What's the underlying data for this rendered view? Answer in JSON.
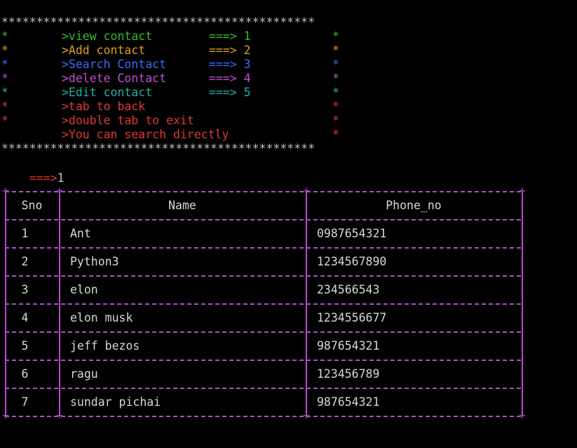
{
  "banner": {
    "border": "*********************************************",
    "star": "*",
    "menu": [
      {
        "label": ">view contact",
        "arrow": "===> 1",
        "color": "#2fbf2f"
      },
      {
        "label": ">Add contact",
        "arrow": "===> 2",
        "color": "#e0a020"
      },
      {
        "label": ">Search Contact",
        "arrow": "===> 3",
        "color": "#3c6cff"
      },
      {
        "label": ">delete Contact",
        "arrow": "===> 4",
        "color": "#c050d8"
      },
      {
        "label": ">Edit contact",
        "arrow": "===> 5",
        "color": "#20b0a8"
      }
    ],
    "notes": [
      {
        "text": ">tab to back",
        "color": "#e03838"
      },
      {
        "text": ">double tab to exit",
        "color": "#e03838"
      },
      {
        "text": ">You can search directly",
        "color": "#e03838"
      }
    ]
  },
  "prompt": {
    "arrow": "===>",
    "input": "1",
    "arrow_color": "#e03838"
  },
  "table": {
    "border_color": "#b44ccc",
    "headers": [
      "Sno",
      "Name",
      "Phone_no"
    ],
    "rows": [
      [
        "1",
        "Ant",
        "0987654321"
      ],
      [
        "2",
        "Python3",
        "1234567890"
      ],
      [
        "3",
        "elon",
        "234566543"
      ],
      [
        "4",
        "elon musk",
        "1234556677"
      ],
      [
        "5",
        "jeff bezos",
        "987654321"
      ],
      [
        "6",
        "ragu",
        "123456789"
      ],
      [
        "7",
        "sundar pichai",
        "987654321"
      ]
    ]
  }
}
